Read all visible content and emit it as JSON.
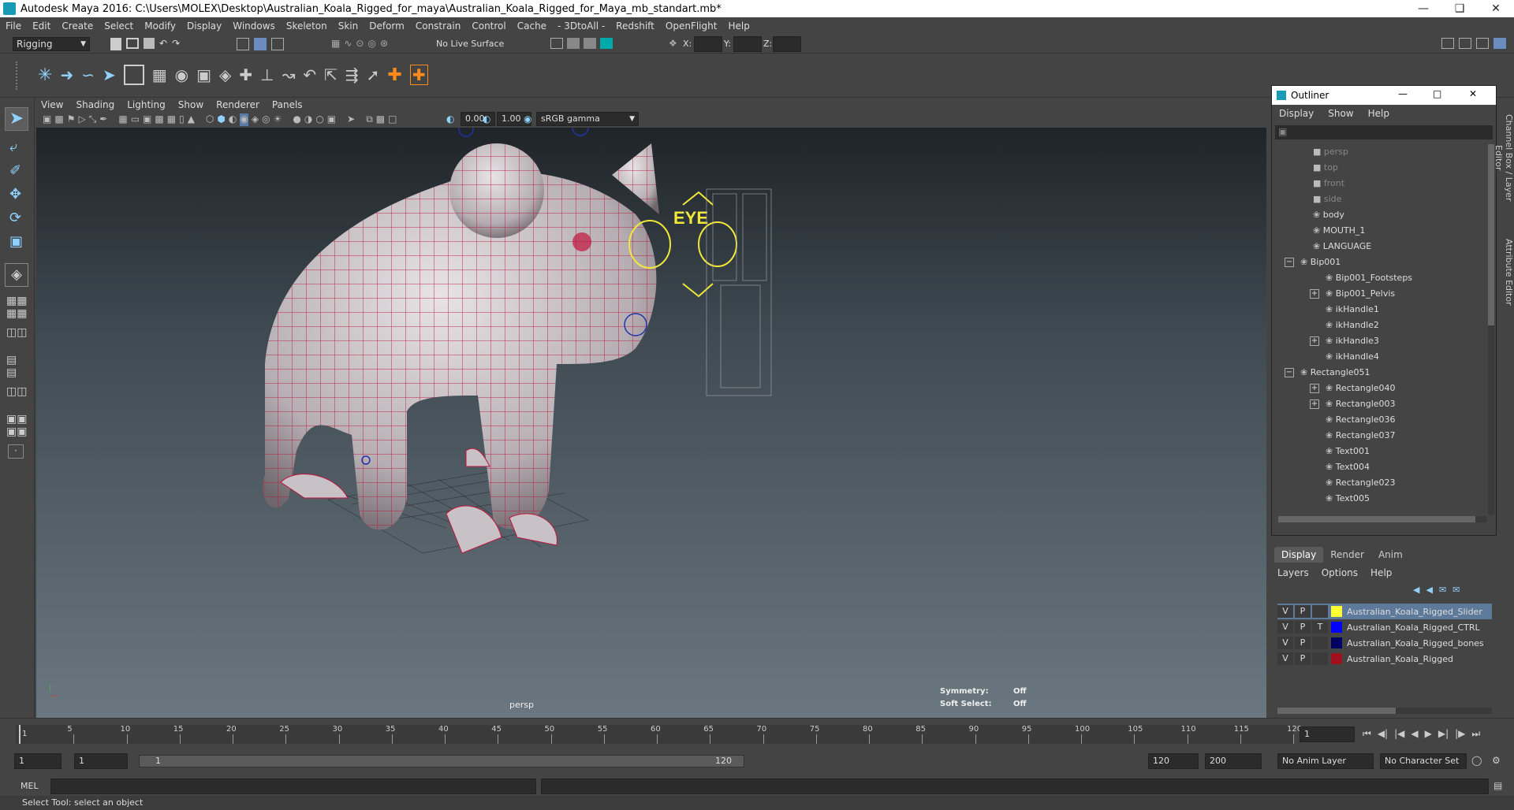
{
  "window": {
    "title": "Autodesk Maya 2016: C:\\Users\\MOLEX\\Desktop\\Australian_Koala_Rigged_for_maya\\Australian_Koala_Rigged_for_Maya_mb_standart.mb*"
  },
  "menubar": [
    "File",
    "Edit",
    "Create",
    "Select",
    "Modify",
    "Display",
    "Windows",
    "Skeleton",
    "Skin",
    "Deform",
    "Constrain",
    "Control",
    "Cache",
    "- 3DtoAll -",
    "Redshift",
    "OpenFlight",
    "Help"
  ],
  "status": {
    "mode": "Rigging",
    "live_surface": "No Live Surface",
    "x_label": "X:",
    "y_label": "Y:",
    "z_label": "Z:"
  },
  "viewport": {
    "menu": [
      "View",
      "Shading",
      "Lighting",
      "Show",
      "Renderer",
      "Panels"
    ],
    "exposure": "0.00",
    "gamma": "1.00",
    "colorspace": "sRGB gamma",
    "camera_label": "persp",
    "symmetry_label": "Symmetry:",
    "symmetry_value": "Off",
    "softselect_label": "Soft Select:",
    "softselect_value": "Off",
    "eye_label": "EYE"
  },
  "outliner": {
    "title": "Outliner",
    "menu": [
      "Display",
      "Show",
      "Help"
    ],
    "items": [
      {
        "label": "persp",
        "dim": true
      },
      {
        "label": "top",
        "dim": true
      },
      {
        "label": "front",
        "dim": true
      },
      {
        "label": "side",
        "dim": true
      },
      {
        "label": "body"
      },
      {
        "label": "MOUTH_1"
      },
      {
        "label": "LANGUAGE"
      },
      {
        "label": "Bip001"
      },
      {
        "label": "Bip001_Footsteps"
      },
      {
        "label": "Bip001_Pelvis"
      },
      {
        "label": "ikHandle1"
      },
      {
        "label": "ikHandle2"
      },
      {
        "label": "ikHandle3"
      },
      {
        "label": "ikHandle4"
      },
      {
        "label": "Rectangle051"
      },
      {
        "label": "Rectangle040"
      },
      {
        "label": "Rectangle003"
      },
      {
        "label": "Rectangle036"
      },
      {
        "label": "Rectangle037"
      },
      {
        "label": "Text001"
      },
      {
        "label": "Text004"
      },
      {
        "label": "Rectangle023"
      },
      {
        "label": "Text005"
      }
    ]
  },
  "layers": {
    "tabs": [
      "Display",
      "Render",
      "Anim"
    ],
    "menu": [
      "Layers",
      "Options",
      "Help"
    ],
    "rows": [
      {
        "v": "V",
        "p": "P",
        "t": "",
        "name": "Australian_Koala_Rigged_Slider",
        "color": "#ffff33",
        "selected": true
      },
      {
        "v": "V",
        "p": "P",
        "t": "T",
        "name": "Australian_Koala_Rigged_CTRL",
        "color": "#0000ff"
      },
      {
        "v": "V",
        "p": "P",
        "t": "",
        "name": "Australian_Koala_Rigged_bones",
        "color": "#000060"
      },
      {
        "v": "V",
        "p": "P",
        "t": "",
        "name": "Australian_Koala_Rigged",
        "color": "#a0101e"
      }
    ]
  },
  "side_tabs": [
    "Channel Box / Layer Editor",
    "Attribute Editor"
  ],
  "timeline": {
    "ticks": [
      "5",
      "10",
      "15",
      "20",
      "25",
      "30",
      "35",
      "40",
      "45",
      "50",
      "55",
      "60",
      "65",
      "70",
      "75",
      "80",
      "85",
      "90",
      "95",
      "100",
      "105",
      "110",
      "115",
      "120"
    ],
    "start_marker": "1",
    "current_frame": "1"
  },
  "range": {
    "start": "1",
    "start2": "1",
    "slider_start": "1",
    "slider_end": "120",
    "end": "120",
    "end2": "200",
    "anim_layer": "No Anim Layer",
    "char_set": "No Character Set"
  },
  "cmd": {
    "label": "MEL"
  },
  "help": "Select Tool: select an object"
}
